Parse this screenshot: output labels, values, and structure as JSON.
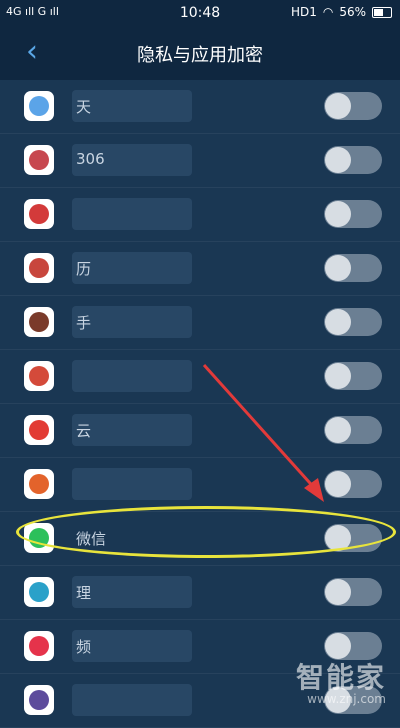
{
  "status_bar": {
    "signal": "4G ıll G ıll",
    "time": "10:48",
    "hd": "HD1",
    "battery": "56%"
  },
  "header": {
    "back_icon": "chevron-left-icon",
    "title": "隐私与应用加密"
  },
  "apps": [
    {
      "name": "天",
      "icon_color": "#5ba4e8",
      "enabled": false
    },
    {
      "name": "306",
      "icon_color": "#c7474f",
      "enabled": false
    },
    {
      "name": "",
      "icon_color": "#d33a3a",
      "enabled": false
    },
    {
      "name": "历",
      "icon_color": "#c8463d",
      "enabled": false
    },
    {
      "name": "手",
      "icon_color": "#7a3a2a",
      "enabled": false
    },
    {
      "name": "",
      "icon_color": "#d44a3a",
      "enabled": false
    },
    {
      "name": "云",
      "icon_color": "#e23b34",
      "enabled": false
    },
    {
      "name": "",
      "icon_color": "#e3632b",
      "enabled": false
    },
    {
      "name": "微信",
      "icon_color": "#2cc05b",
      "enabled": false
    },
    {
      "name": "理",
      "icon_color": "#2aa1c9",
      "enabled": false
    },
    {
      "name": "频",
      "icon_color": "#e5334b",
      "enabled": false
    },
    {
      "name": "",
      "icon_color": "#5d4b9c",
      "enabled": false
    }
  ],
  "watermark": {
    "main": "智能家",
    "sub": "www.znj.com"
  }
}
